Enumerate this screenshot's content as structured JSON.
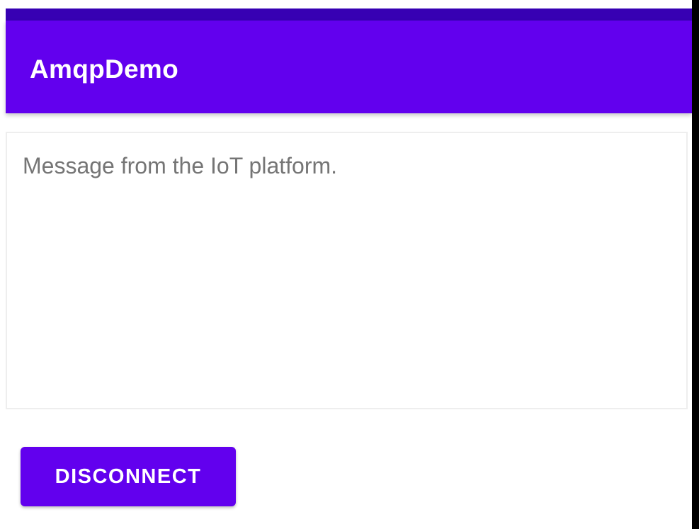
{
  "app_bar": {
    "title": "AmqpDemo",
    "color": "#6200EE",
    "status_bar_color": "#3700B3"
  },
  "message": {
    "text": "Message from the IoT platform."
  },
  "actions": {
    "disconnect_label": "DISCONNECT"
  }
}
